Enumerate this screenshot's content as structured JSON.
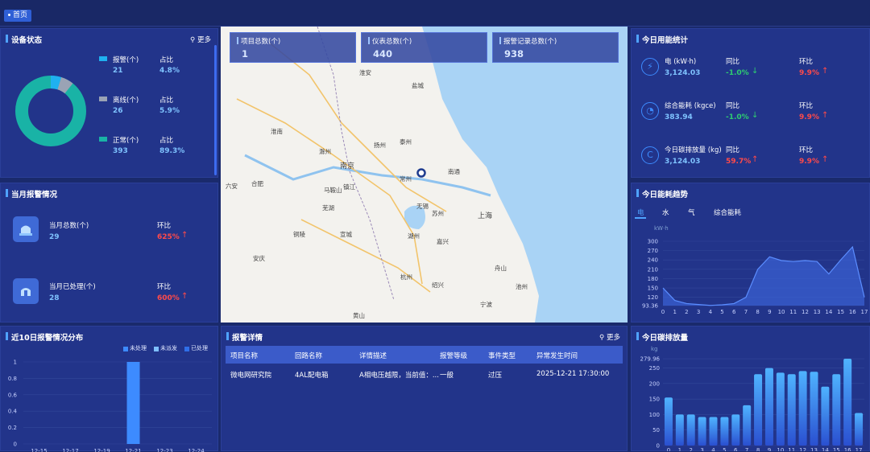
{
  "breadcrumb": {
    "home": "首页"
  },
  "device_status": {
    "title": "设备状态",
    "more": "更多",
    "items": [
      {
        "label": "报警(个)",
        "value": "21",
        "ratio_label": "占比",
        "ratio": "4.8%",
        "color": "#1fb1f0"
      },
      {
        "label": "离线(个)",
        "value": "26",
        "ratio_label": "占比",
        "ratio": "5.9%",
        "color": "#9aa3b5"
      },
      {
        "label": "正常(个)",
        "value": "393",
        "ratio_label": "占比",
        "ratio": "89.3%",
        "color": "#19b3a6"
      }
    ]
  },
  "stats": {
    "projects": {
      "label": "项目总数(个)",
      "value": "1"
    },
    "meters": {
      "label": "仪表总数(个)",
      "value": "440"
    },
    "alarms": {
      "label": "报警记录总数(个)",
      "value": "938"
    }
  },
  "energy_today": {
    "title": "今日用能统计",
    "rows": [
      {
        "icon": "lightning-icon",
        "label": "电 (kW·h)",
        "value": "3,124.03",
        "yoy_label": "同比",
        "yoy": "-1.0%",
        "mom_label": "环比",
        "mom": "9.9%"
      },
      {
        "icon": "gauge-icon",
        "label": "综合能耗 (kgce)",
        "value": "383.94",
        "yoy_label": "同比",
        "yoy": "-1.0%",
        "mom_label": "环比",
        "mom": "9.9%"
      },
      {
        "icon": "carbon-icon",
        "label": "今日碳排放量 (kg)",
        "value": "3,124.03",
        "yoy_label": "同比",
        "yoy": "59.7%",
        "mom_label": "环比",
        "mom": "9.9%"
      }
    ]
  },
  "monthly_alarm": {
    "title": "当月报警情况",
    "total_label": "当月总数(个)",
    "total": "29",
    "total_mom_label": "环比",
    "total_mom": "625%",
    "handled_label": "当月已处理(个)",
    "handled": "28",
    "handled_mom_label": "环比",
    "handled_mom": "600%"
  },
  "trend": {
    "title": "今日能耗趋势",
    "tabs": [
      "电",
      "水",
      "气",
      "综合能耗"
    ],
    "unit": "kW·h",
    "chart_data": {
      "type": "area",
      "x": [
        0,
        1,
        2,
        3,
        4,
        5,
        6,
        7,
        8,
        9,
        10,
        11,
        12,
        13,
        14,
        15,
        16,
        17
      ],
      "y_ticks": [
        "300",
        "270",
        "240",
        "210",
        "180",
        "150",
        "120",
        "93.36"
      ],
      "values": [
        150,
        110,
        100,
        97,
        94,
        96,
        100,
        120,
        210,
        250,
        238,
        235,
        238,
        235,
        195,
        240,
        282,
        120
      ],
      "ylim": [
        93.36,
        300
      ]
    }
  },
  "alarm_dist": {
    "title": "近10日报警情况分布",
    "legend": [
      "未处理",
      "未派发",
      "已处理"
    ],
    "legend_colors": [
      "#3d8bff",
      "#7fbfff",
      "#2f6fe8"
    ],
    "chart_data": {
      "type": "bar",
      "categories": [
        "12-15",
        "12-17",
        "12-19",
        "12-21",
        "12-23",
        "12-24"
      ],
      "y_ticks": [
        "1",
        "0.8",
        "0.6",
        "0.4",
        "0.2",
        "0"
      ],
      "values": [
        0,
        0,
        0,
        1,
        0,
        0
      ],
      "ylim": [
        0,
        1
      ]
    }
  },
  "alarm_detail": {
    "title": "报警详情",
    "more": "更多",
    "columns": [
      "项目名称",
      "回路名称",
      "详情描述",
      "报警等级",
      "事件类型",
      "异常发生时间"
    ],
    "rows": [
      [
        "微电网研究院",
        "4AL配电箱",
        "A相电压越限，当前值：...",
        "一般",
        "过压",
        "2025-12-21 17:30:00"
      ]
    ]
  },
  "carbon": {
    "title": "今日碳排放量",
    "unit": "kg",
    "chart_data": {
      "type": "bar",
      "categories": [
        "0",
        "1",
        "2",
        "3",
        "4",
        "5",
        "6",
        "7",
        "8",
        "9",
        "10",
        "11",
        "12",
        "13",
        "14",
        "15",
        "16",
        "17"
      ],
      "y_ticks": [
        "279.96",
        "250",
        "200",
        "150",
        "100",
        "50",
        "0"
      ],
      "values": [
        155,
        100,
        100,
        92,
        92,
        92,
        100,
        130,
        230,
        250,
        235,
        230,
        240,
        238,
        190,
        230,
        280,
        105
      ],
      "ylim": [
        0,
        280
      ]
    }
  },
  "map": {
    "labels": [
      "淮安",
      "盐城",
      "淮南",
      "泰州",
      "扬州",
      "滁州",
      "南京",
      "镇江",
      "常州",
      "南通",
      "合肥",
      "六安",
      "马鞍山",
      "芜湖",
      "无锡",
      "苏州",
      "上海",
      "铜陵",
      "宣城",
      "湖州",
      "嘉兴",
      "安庆",
      "杭州",
      "绍兴",
      "宁波",
      "舟山",
      "池州",
      "黄山"
    ]
  }
}
